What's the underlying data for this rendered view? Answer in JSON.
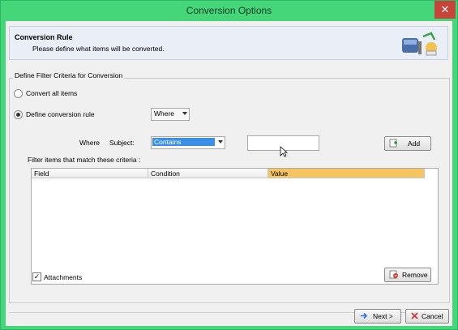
{
  "window": {
    "title": "Conversion Options",
    "close_glyph": "✕"
  },
  "header": {
    "title": "Conversion Rule",
    "subtitle": "Please define what items will be converted."
  },
  "group": {
    "legend": "Define Filter Criteria for Conversion",
    "convert_all_label": "Convert all items",
    "define_rule_label": "Define conversion rule",
    "define_rule_selected": true,
    "where_dropdown_value": "Where",
    "where_label": "Where",
    "field_label": "Subject:",
    "condition_value": "Contains",
    "value_input": "",
    "add_label": "Add",
    "filter_caption": "Filter items that match these criteria :",
    "columns": [
      "Field",
      "Condition",
      "Value"
    ],
    "attachments_label": "Attachments",
    "attachments_checked": true,
    "remove_label": "Remove"
  },
  "footer": {
    "next_label": "Next >",
    "cancel_label": "Cancel"
  },
  "colors": {
    "titlebar": "#45d67a",
    "header_bg": "#e9eef7",
    "selection": "#3a8ee6",
    "column_highlight": "#f6c562",
    "close_btn": "#c7443b"
  }
}
